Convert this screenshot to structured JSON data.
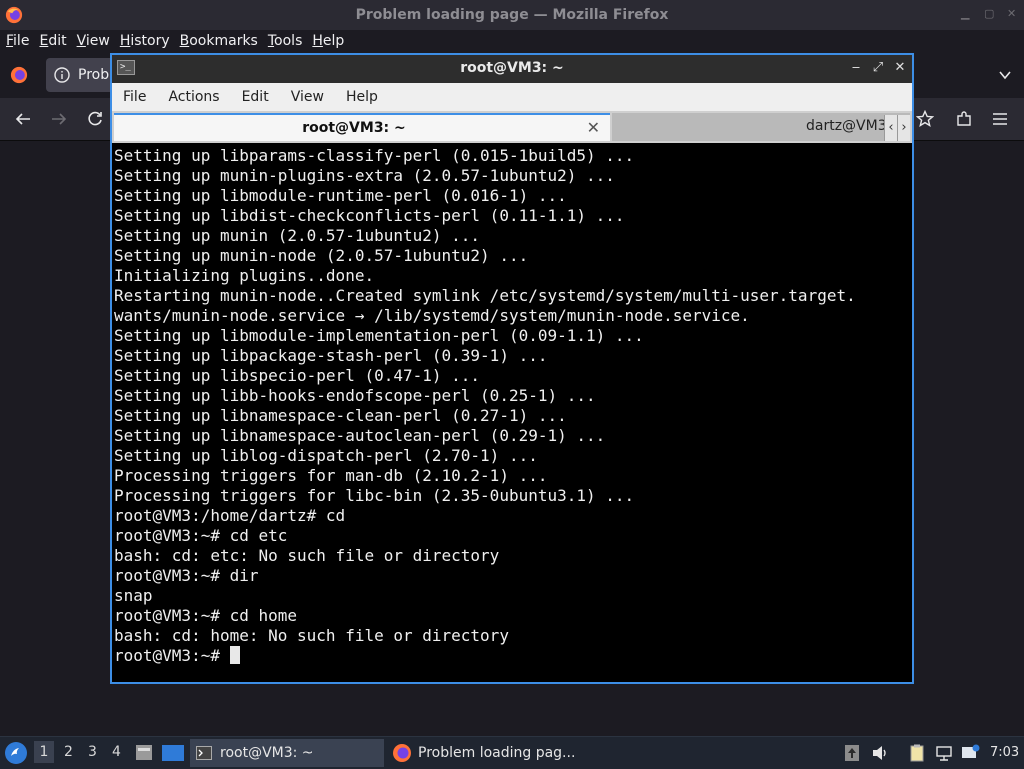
{
  "firefox": {
    "window_title": "Problem loading page — Mozilla Firefox",
    "menu": [
      "File",
      "Edit",
      "View",
      "History",
      "Bookmarks",
      "Tools",
      "Help"
    ],
    "active_tab_label": "Probl"
  },
  "terminal": {
    "window_title": "root@VM3: ~",
    "menu": [
      "File",
      "Actions",
      "Edit",
      "View",
      "Help"
    ],
    "tabs": [
      {
        "label": "root@VM3: ~",
        "active": true
      },
      {
        "label": "dartz@VM3",
        "active": false
      }
    ],
    "lines": [
      "Setting up libparams-classify-perl (0.015-1build5) ...",
      "Setting up munin-plugins-extra (2.0.57-1ubuntu2) ...",
      "Setting up libmodule-runtime-perl (0.016-1) ...",
      "Setting up libdist-checkconflicts-perl (0.11-1.1) ...",
      "Setting up munin (2.0.57-1ubuntu2) ...",
      "Setting up munin-node (2.0.57-1ubuntu2) ...",
      "Initializing plugins..done.",
      "Restarting munin-node..Created symlink /etc/systemd/system/multi-user.target.",
      "wants/munin-node.service → /lib/systemd/system/munin-node.service.",
      "Setting up libmodule-implementation-perl (0.09-1.1) ...",
      "Setting up libpackage-stash-perl (0.39-1) ...",
      "Setting up libspecio-perl (0.47-1) ...",
      "Setting up libb-hooks-endofscope-perl (0.25-1) ...",
      "Setting up libnamespace-clean-perl (0.27-1) ...",
      "Setting up libnamespace-autoclean-perl (0.29-1) ...",
      "Setting up liblog-dispatch-perl (2.70-1) ...",
      "Processing triggers for man-db (2.10.2-1) ...",
      "Processing triggers for libc-bin (2.35-0ubuntu3.1) ...",
      "root@VM3:/home/dartz# cd",
      "root@VM3:~# cd etc",
      "bash: cd: etc: No such file or directory",
      "root@VM3:~# dir",
      "snap",
      "root@VM3:~# cd home",
      "bash: cd: home: No such file or directory"
    ],
    "prompt": "root@VM3:~# "
  },
  "taskbar": {
    "workspaces": [
      "1",
      "2",
      "3",
      "4"
    ],
    "tasks": [
      {
        "label": "root@VM3: ~"
      },
      {
        "label": "Problem loading pag..."
      }
    ],
    "clock": "7:03"
  },
  "colors": {
    "terminal_focus_border": "#3d8ee6",
    "firefox_bg": "#1c1b22",
    "taskbar_bg": "#1f2530"
  }
}
